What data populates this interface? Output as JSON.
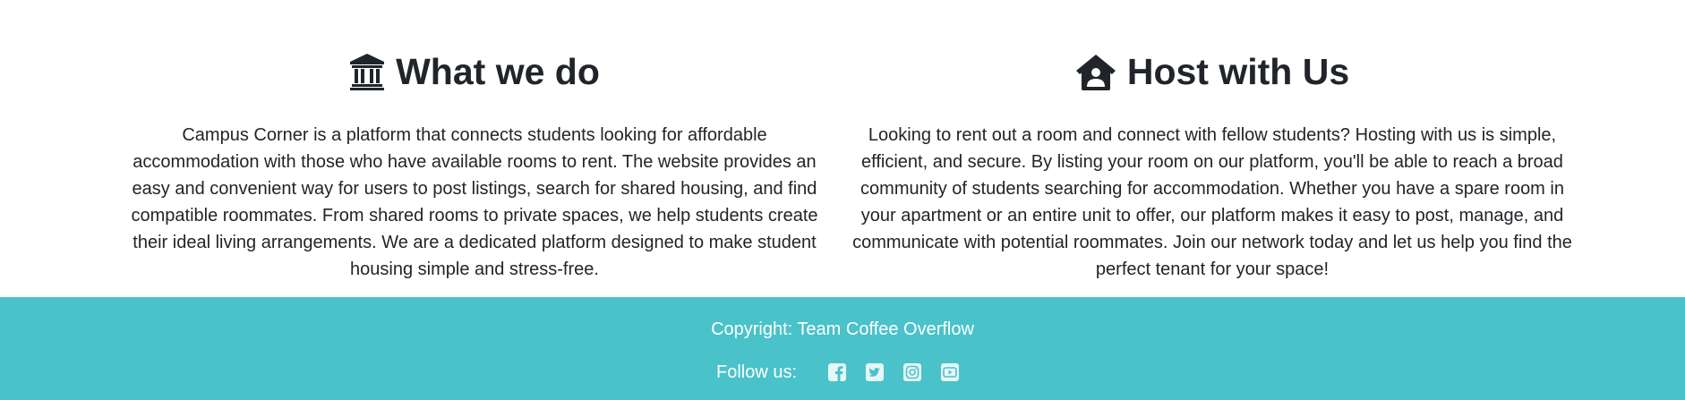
{
  "about": {
    "what_we_do": {
      "icon": "bank-icon",
      "title": "What we do",
      "text": "Campus Corner is a platform that connects students looking for affordable accommodation with those who have available rooms to rent. The website provides an easy and convenient way for users to post listings, search for shared housing, and find compatible roommates. From shared rooms to private spaces, we help students create their ideal living arrangements. We are a dedicated platform designed to make student housing simple and stress-free."
    },
    "host_with_us": {
      "icon": "house-user-icon",
      "title": "Host with Us",
      "text": "Looking to rent out a room and connect with fellow students? Hosting with us is simple, efficient, and secure. By listing your room on our platform, you'll be able to reach a broad community of students searching for accommodation. Whether you have a spare room in your apartment or an entire unit to offer, our platform makes it easy to post, manage, and communicate with potential roommates. Join our network today and let us help you find the perfect tenant for your space!"
    }
  },
  "footer": {
    "copyright": "Copyright: Team Coffee Overflow",
    "follow_label": "Follow us:",
    "social": [
      {
        "icon": "facebook-icon"
      },
      {
        "icon": "twitter-icon"
      },
      {
        "icon": "instagram-icon"
      },
      {
        "icon": "youtube-icon"
      }
    ],
    "background_color": "#4ac2c9",
    "text_color": "#ffffff"
  }
}
